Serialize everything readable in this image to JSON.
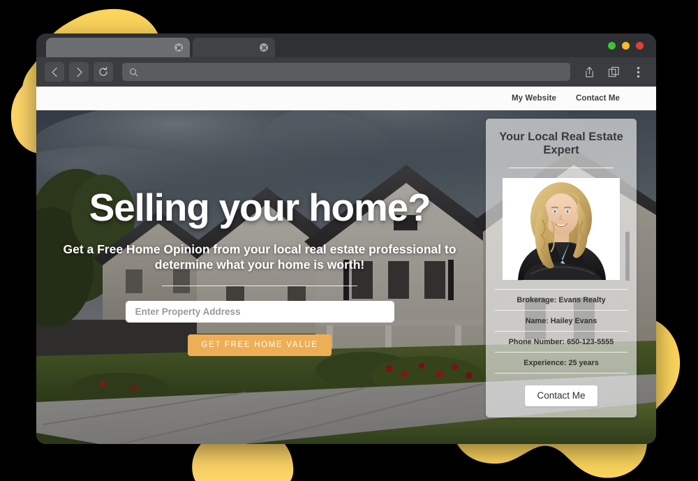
{
  "colors": {
    "blob_yellow": "#fbd45c",
    "blob_yellow_soft": "#fdd468",
    "cta_orange": "#eeae56",
    "browser_chrome": "#2f3033",
    "toolbar": "#3a3c40",
    "traffic_green": "#3cc13b",
    "traffic_yellow": "#f2bd2a",
    "traffic_red": "#e0403a"
  },
  "browser": {
    "tabs": [
      {
        "title": "",
        "active": true,
        "close_icon": "close-icon"
      },
      {
        "title": "",
        "active": false,
        "close_icon": "close-icon"
      }
    ],
    "window_buttons": [
      "maximize-dot",
      "minimize-dot",
      "close-dot"
    ],
    "toolbar": {
      "back_icon": "chevron-left-icon",
      "forward_icon": "chevron-right-icon",
      "reload_icon": "reload-icon",
      "search_icon": "search-icon",
      "address_value": "",
      "address_placeholder": "",
      "share_icon": "share-icon",
      "tabs_icon": "copy-tabs-icon",
      "menu_icon": "more-vertical-icon"
    }
  },
  "site": {
    "nav": [
      {
        "label": "My Website"
      },
      {
        "label": "Contact Me"
      }
    ],
    "hero": {
      "headline": "Selling your home?",
      "subheadline": "Get a Free Home Opinion from your local real estate professional to determine what your home is worth!",
      "address_input_value": "",
      "address_input_placeholder": "Enter Property Address",
      "cta_label": "GET FREE HOME VALUE",
      "background_image_alt": "suburban-houses-street-photo"
    },
    "agent_card": {
      "title": "Your Local Real Estate Expert",
      "photo_alt": "agent-headshot-blonde-woman-black-blazer",
      "details": [
        {
          "label": "Brokerage",
          "value": "Evans Realty",
          "text": "Brokerage: Evans Realty"
        },
        {
          "label": "Name",
          "value": "Hailey Evans",
          "text": "Name: Hailey Evans"
        },
        {
          "label": "Phone Number",
          "value": "650-123-5555",
          "text": "Phone Number: 650-123-5555"
        },
        {
          "label": "Experience",
          "value": "25 years",
          "text": "Experience: 25 years"
        }
      ],
      "contact_label": "Contact Me"
    }
  }
}
